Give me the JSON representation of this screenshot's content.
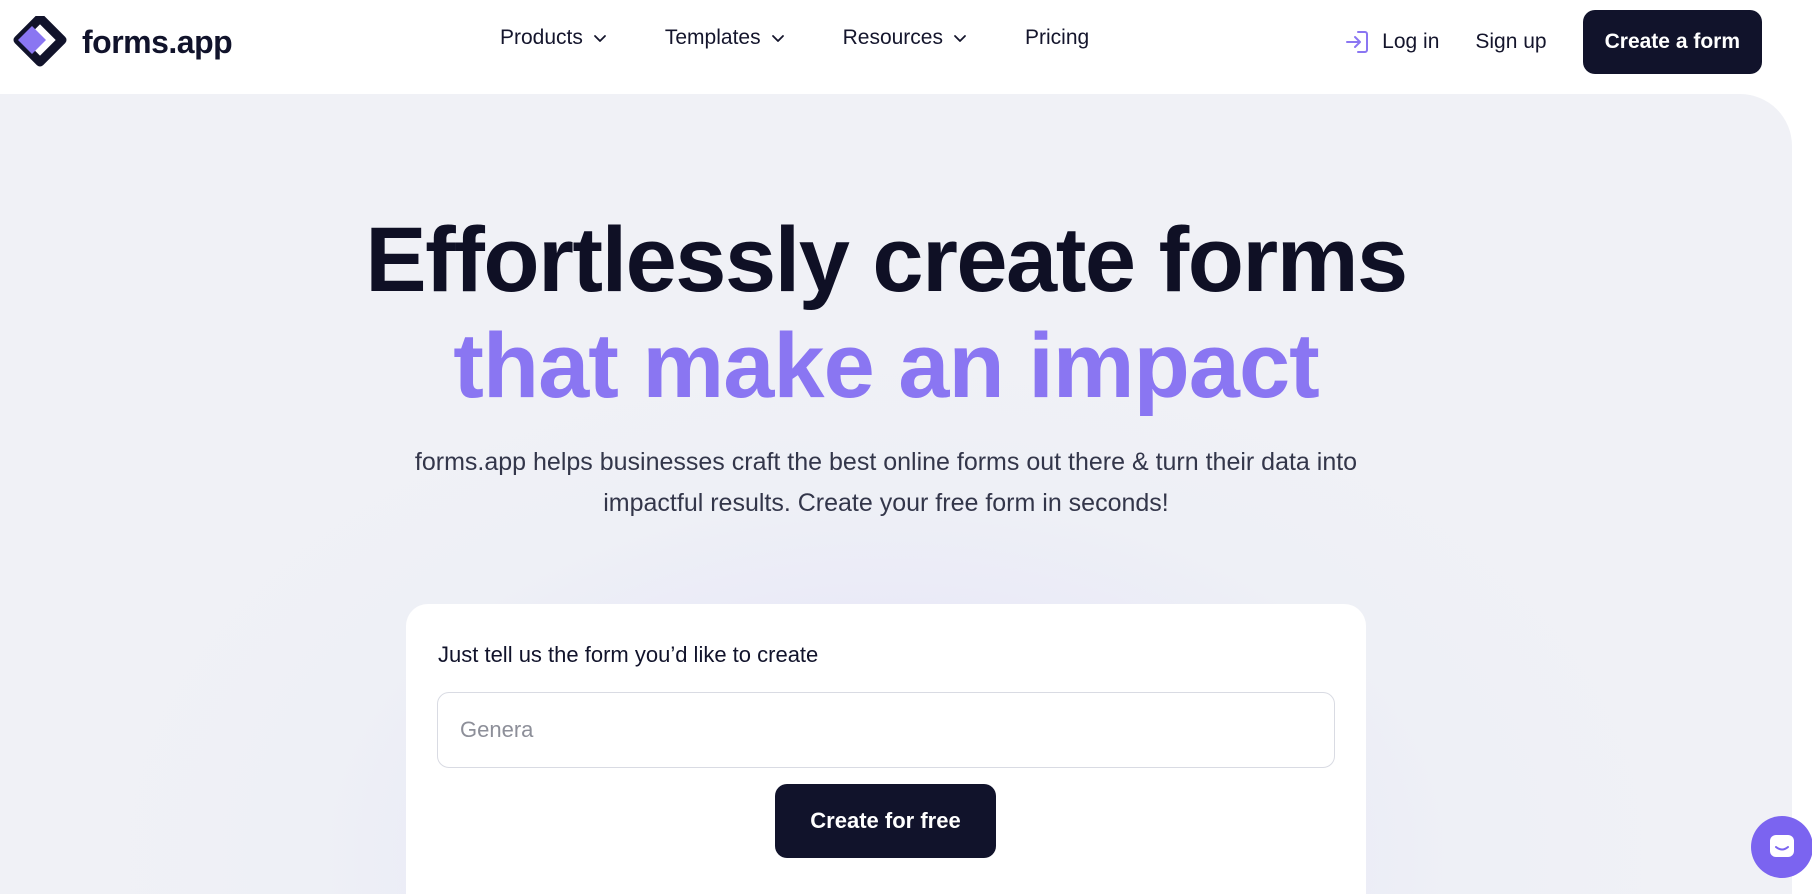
{
  "brand": {
    "name": "forms.app",
    "accent_color": "#8a76f2",
    "dark_color": "#11132b"
  },
  "nav": {
    "items": [
      {
        "label": "Products",
        "has_dropdown": true
      },
      {
        "label": "Templates",
        "has_dropdown": true
      },
      {
        "label": "Resources",
        "has_dropdown": true
      },
      {
        "label": "Pricing",
        "has_dropdown": false
      }
    ]
  },
  "header_actions": {
    "login_label": "Log in",
    "signup_label": "Sign up",
    "create_form_label": "Create a form"
  },
  "hero": {
    "title_line1": "Effortlessly create forms",
    "title_line2": "that make an impact",
    "subtitle": "forms.app helps businesses craft the best online forms out there & turn their data into impactful results. Create your free form in seconds!"
  },
  "generator_card": {
    "label": "Just tell us the form you’d like to create",
    "input_placeholder": "Genera",
    "input_value": "",
    "submit_label": "Create for free"
  },
  "chat_widget": {
    "icon": "chat-bubble-icon"
  }
}
